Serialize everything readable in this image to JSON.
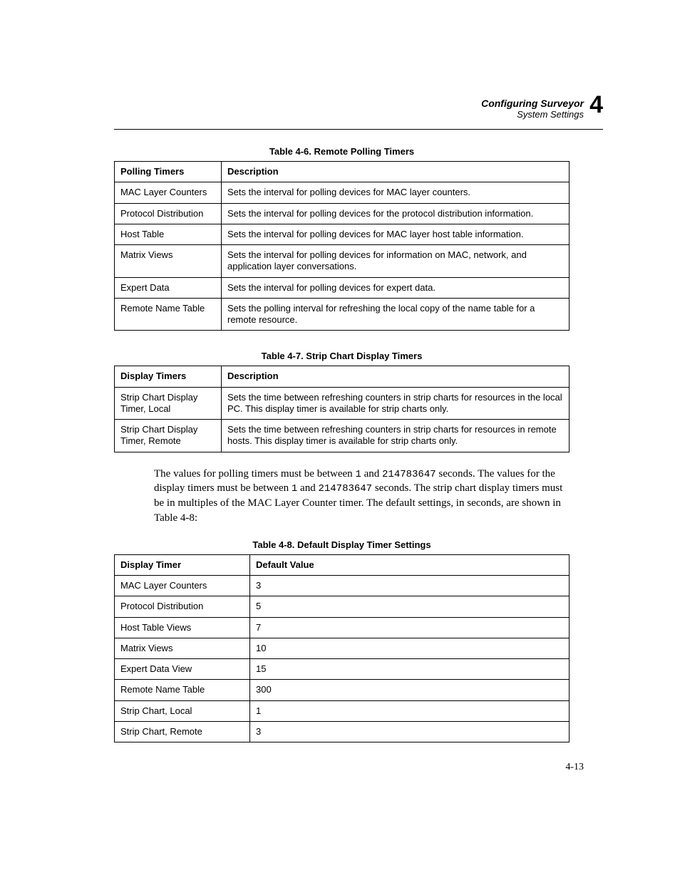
{
  "header": {
    "line1": "Configuring Surveyor",
    "line2": "System Settings",
    "chapter_number": "4"
  },
  "table_4_6": {
    "caption": "Table 4-6. Remote Polling Timers",
    "headers": [
      "Polling Timers",
      "Description"
    ],
    "rows": [
      [
        "MAC Layer Counters",
        "Sets the interval for polling devices for MAC layer counters."
      ],
      [
        "Protocol Distribution",
        "Sets the interval for polling devices for the protocol distribution information."
      ],
      [
        "Host Table",
        "Sets the interval for polling devices for MAC layer host table information."
      ],
      [
        "Matrix Views",
        "Sets the interval for polling devices for information on MAC, network, and application layer conversations."
      ],
      [
        "Expert Data",
        "Sets the interval for polling devices for expert data."
      ],
      [
        "Remote Name Table",
        "Sets the polling interval for refreshing the local copy of the name table for a remote resource."
      ]
    ]
  },
  "table_4_7": {
    "caption": "Table 4-7. Strip Chart Display Timers",
    "headers": [
      "Display Timers",
      "Description"
    ],
    "rows": [
      [
        "Strip Chart Display Timer, Local",
        "Sets the time between refreshing counters in strip charts for resources in the local PC. This display timer is available for strip charts only."
      ],
      [
        "Strip Chart Display Timer, Remote",
        "Sets the time between refreshing counters in strip charts for resources in remote hosts. This display timer is available for strip charts only."
      ]
    ]
  },
  "paragraph": {
    "p1a": "The values for polling timers must be between ",
    "p1b": "1",
    "p1c": " and ",
    "p1d": "214783647",
    "p1e": " seconds. The values for the display timers must be between ",
    "p1f": "1",
    "p1g": " and ",
    "p1h": "214783647",
    "p1i": " seconds. The strip chart display timers must be in multiples of the MAC Layer Counter timer. The default settings, in seconds, are shown in Table 4-8:"
  },
  "table_4_8": {
    "caption": "Table 4-8. Default Display Timer Settings",
    "headers": [
      "Display Timer",
      "Default Value"
    ],
    "rows": [
      [
        "MAC Layer Counters",
        "3"
      ],
      [
        "Protocol Distribution",
        "5"
      ],
      [
        "Host Table Views",
        "7"
      ],
      [
        "Matrix Views",
        "10"
      ],
      [
        "Expert Data View",
        "15"
      ],
      [
        "Remote Name Table",
        "300"
      ],
      [
        "Strip Chart, Local",
        "1"
      ],
      [
        "Strip Chart, Remote",
        "3"
      ]
    ]
  },
  "page_number": "4-13"
}
